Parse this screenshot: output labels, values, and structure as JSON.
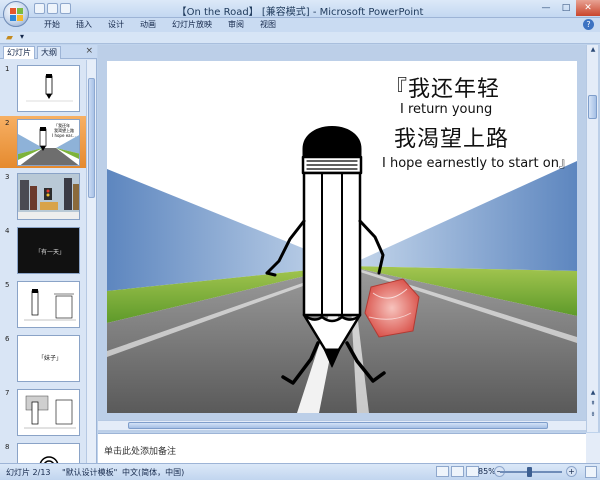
{
  "window": {
    "title": "【On the Road】 [兼容模式] - Microsoft PowerPoint"
  },
  "ribbon": {
    "tabs": [
      "开始",
      "插入",
      "设计",
      "动画",
      "幻灯片放映",
      "审阅",
      "视图"
    ],
    "help": "?"
  },
  "left_panel": {
    "tabs": [
      "幻灯片",
      "大纲"
    ],
    "close": "×",
    "slide_numbers": [
      "1",
      "2",
      "3",
      "4",
      "5",
      "6",
      "7",
      "8"
    ],
    "selected_slide": 2,
    "thumb_texts": {
      "s4": "「有一天」",
      "s6": "「妹子」",
      "s2_lines": [
        "「我还年",
        "我渴望上路",
        "I hope ear..."
      ]
    }
  },
  "slide": {
    "line1_cn": "『我还年轻",
    "line1_en": "I return young",
    "line2_cn": "我渴望上路",
    "line2_en": "I hope earnestly to start on』"
  },
  "notes": {
    "placeholder": "单击此处添加备注"
  },
  "status": {
    "slide_counter": "幻灯片 2/13",
    "theme": "\"默认设计模板\"",
    "language": "中文(简体，中国)",
    "zoom": "85%"
  },
  "colors": {
    "accent": "#e58a2e",
    "chrome": "#bfd3ec"
  }
}
